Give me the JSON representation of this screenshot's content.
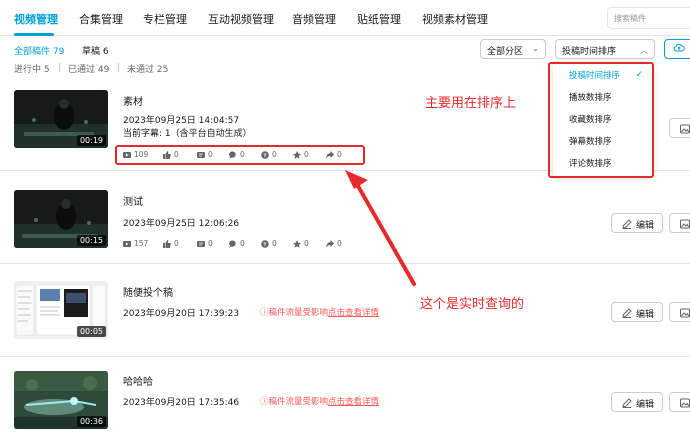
{
  "nav": {
    "tabs": [
      {
        "label": "视频管理",
        "active": true
      },
      {
        "label": "合集管理"
      },
      {
        "label": "专栏管理"
      },
      {
        "label": "互动视频管理"
      },
      {
        "label": "音频管理"
      },
      {
        "label": "贴纸管理"
      },
      {
        "label": "视频素材管理"
      }
    ],
    "search_placeholder": "搜索稿件"
  },
  "filters": {
    "all": "全部稿件 79",
    "draft": "草稿 6",
    "in_progress": "进行中 5",
    "passed": "已通过 49",
    "failed": "未通过 25",
    "zone_select": "全部分区",
    "sort_select": "投稿时间排序"
  },
  "sort_dropdown": {
    "options": [
      "投稿时间排序",
      "播放数排序",
      "收藏数排序",
      "弹幕数排序",
      "评论数排序"
    ],
    "selected_index": 0
  },
  "videos": [
    {
      "title": "素材",
      "time": "2023年09月25日 14:04:57",
      "subtitle": "当前字幕: 1（含平台自动生成）",
      "duration": "00:19",
      "stats": [
        "109",
        "0",
        "0",
        "0",
        "0",
        "0",
        "0"
      ]
    },
    {
      "title": "测试",
      "time": "2023年09月25日 12:06:26",
      "duration": "00:15",
      "stats": [
        "157",
        "0",
        "0",
        "0",
        "0",
        "0",
        "0"
      ]
    },
    {
      "title": "随便投个稿",
      "time": "2023年09月20日 17:39:23",
      "duration": "00:05",
      "warning": "稿件流量受影响",
      "warning_link": "点击查看详情"
    },
    {
      "title": "哈哈哈",
      "time": "2023年09月20日 17:35:46",
      "duration": "00:36",
      "warning": "稿件流量受影响",
      "warning_link": "点击查看详情"
    }
  ],
  "actions": {
    "edit_label": "编辑"
  },
  "annotations": {
    "sort_note": "主要用在排序上",
    "realtime_note": "这个是实时查询的"
  },
  "colors": {
    "accent": "#00a1d6",
    "annotation": "#e62a2a",
    "warning": "#f85a54"
  }
}
